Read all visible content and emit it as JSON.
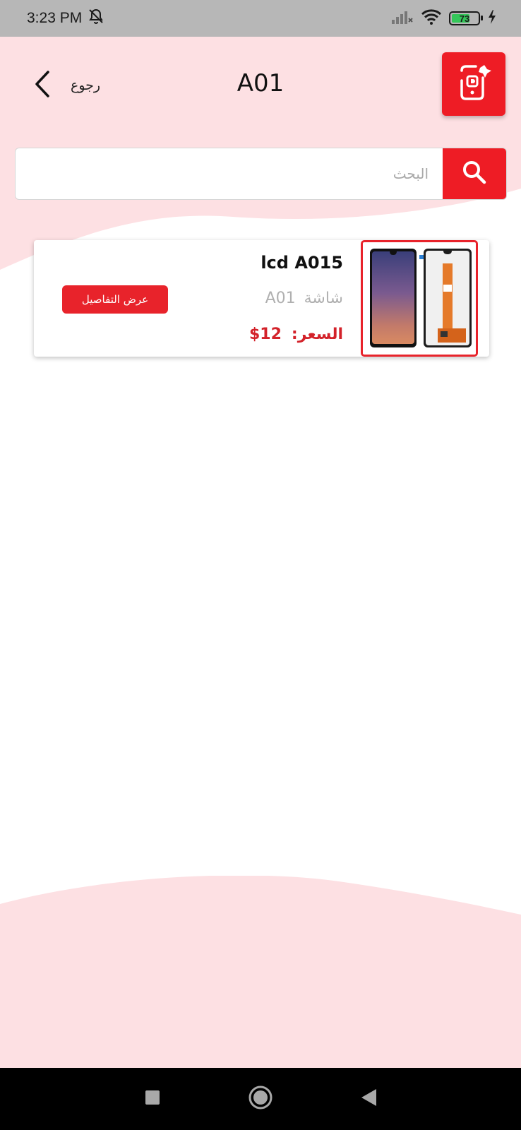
{
  "status_bar": {
    "time": "3:23 PM",
    "battery_level": "73",
    "battery_fraction": 0.73
  },
  "header": {
    "back_label": "رجوع",
    "title": "A01"
  },
  "search": {
    "placeholder": "البحث",
    "value": ""
  },
  "products": [
    {
      "name": "lcd A015",
      "category_label": "شاشة",
      "model": "A01",
      "price_label": "السعر:",
      "price": "$12",
      "details_label": "عرض التفاصيل"
    }
  ],
  "colors": {
    "accent": "#ee1c25",
    "price": "#d3222a",
    "pink_bg": "#fde0e3",
    "status_bar_bg": "#b7b7b7"
  },
  "icons": [
    "mute-bell-icon",
    "signal-icon",
    "wifi-icon",
    "battery-icon",
    "charging-icon",
    "chevron-left-icon",
    "app-logo-icon",
    "search-icon",
    "recent-apps-icon",
    "home-icon",
    "back-icon"
  ]
}
